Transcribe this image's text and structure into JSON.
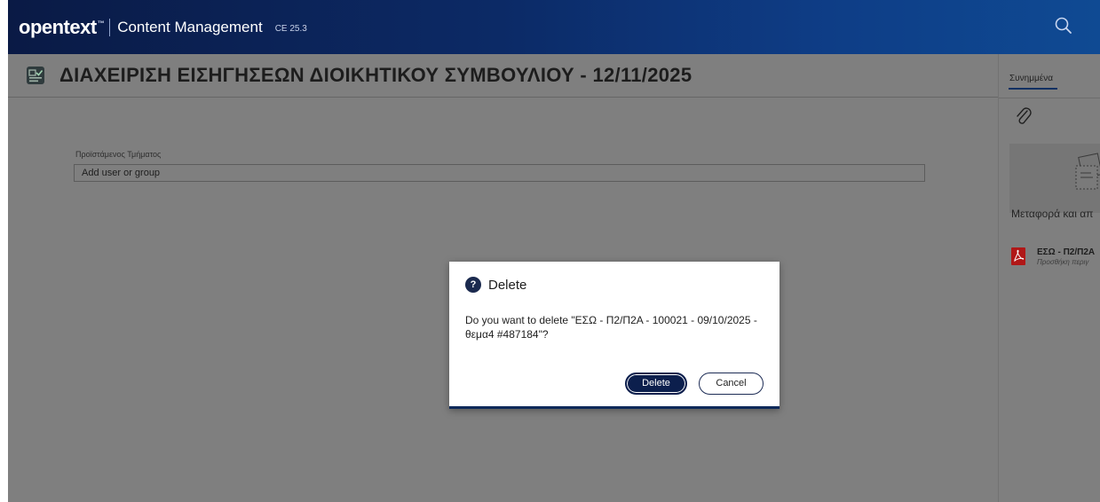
{
  "topbar": {
    "brand": "opentext",
    "brand_mark": "™",
    "app_title": "Content Management",
    "version": "CE 25.3",
    "search_icon": "search-icon"
  },
  "page": {
    "icon": "form-icon",
    "title": "ΔΙΑΧΕΙΡΙΣΗ ΕΙΣΗΓΗΣΕΩΝ ΔΙΟΙΚΗΤΙΚΟΥ ΣΥΜΒΟΥΛΙΟΥ - 12/11/2025"
  },
  "form": {
    "field_label": "Προϊστάμενος Τμήματος",
    "field_placeholder": "Add user or group"
  },
  "right_panel": {
    "tab_label": "Συνημμένα",
    "attach_icon": "paperclip-icon",
    "drop_text": "Μεταφορά και απ",
    "file": {
      "icon": "pdf-icon",
      "name": "ΕΣΩ - Π2/Π2Α",
      "sub": "Προσθήκη περιγ"
    }
  },
  "dialog": {
    "icon": "help-icon",
    "title": "Delete",
    "message": "Do you want to delete \"ΕΣΩ - Π2/Π2Α - 100021 - 09/10/2025 - θεμα4 #487184\"?",
    "confirm_label": "Delete",
    "cancel_label": "Cancel"
  },
  "colors": {
    "topbar_dark": "#0a1a45",
    "topbar_light": "#0f4a93",
    "primary_button": "#0c1f4d",
    "overlay_gray": "#7f7f7f",
    "pdf_red": "#b01717"
  }
}
